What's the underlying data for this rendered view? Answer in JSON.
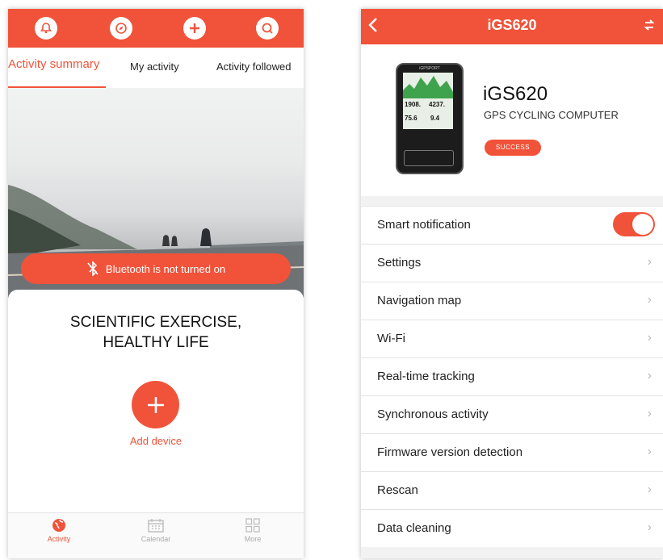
{
  "colors": {
    "accent": "#f0533a",
    "muted": "#aaaaaa",
    "chevron": "#bbbbbb"
  },
  "left": {
    "top_icons": [
      "bell-icon",
      "compass-icon",
      "plus-icon",
      "search-icon"
    ],
    "tabs": [
      {
        "label": "Activity summary",
        "active": true
      },
      {
        "label": "My activity",
        "active": false
      },
      {
        "label": "Activity followed",
        "active": false
      }
    ],
    "bluetooth_message": "Bluetooth is not turned on",
    "slogan_line1": "SCIENTIFIC EXERCISE,",
    "slogan_line2": "HEALTHY LIFE",
    "add_device_label": "Add device",
    "bottom_nav": [
      {
        "label": "Activity",
        "icon": "globe-icon",
        "active": true
      },
      {
        "label": "Calendar",
        "icon": "calendar-icon",
        "active": false
      },
      {
        "label": "More",
        "icon": "grid-icon",
        "active": false
      }
    ]
  },
  "right": {
    "header_title": "iGS620",
    "device": {
      "name": "iGS620",
      "subtitle": "GPS CYCLING COMPUTER",
      "status": "SUCCESS",
      "screen_brand": "iGPSPORT",
      "screen_values": [
        "1908.",
        "4237.",
        "75.6",
        "9.4"
      ]
    },
    "menu": [
      {
        "label": "Smart notification",
        "type": "toggle",
        "on": true
      },
      {
        "label": "Settings",
        "type": "link"
      },
      {
        "label": "Navigation map",
        "type": "link"
      },
      {
        "label": "Wi-Fi",
        "type": "link"
      },
      {
        "label": "Real-time tracking",
        "type": "link"
      },
      {
        "label": "Synchronous activity",
        "type": "link"
      },
      {
        "label": "Firmware version detection",
        "type": "link"
      },
      {
        "label": "Rescan",
        "type": "link"
      },
      {
        "label": "Data cleaning",
        "type": "link"
      }
    ]
  }
}
